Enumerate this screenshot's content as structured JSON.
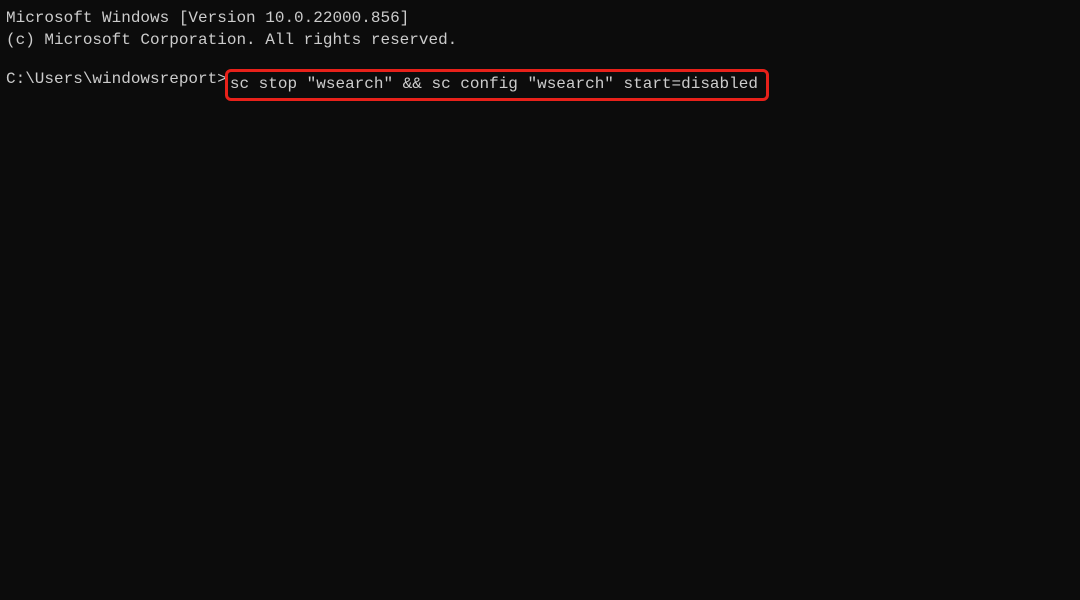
{
  "terminal": {
    "header_line1": "Microsoft Windows [Version 10.0.22000.856]",
    "header_line2": "(c) Microsoft Corporation. All rights reserved.",
    "prompt": "C:\\Users\\windowsreport>",
    "command": "sc stop \"wsearch\" && sc config \"wsearch\" start=disabled"
  },
  "annotation": {
    "highlight_color": "#e8211a"
  }
}
